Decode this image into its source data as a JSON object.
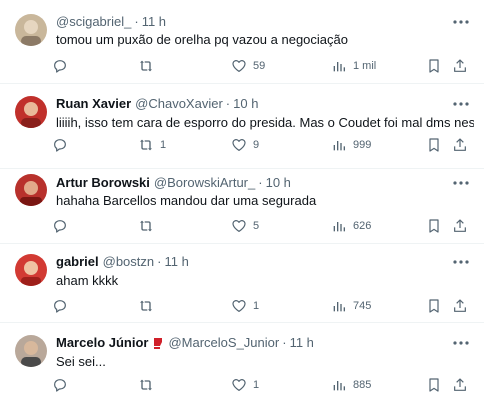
{
  "tweets": [
    {
      "name": "",
      "handle": "@scigabriel_",
      "dot": "·",
      "time": "11 h",
      "text": "tomou um puxão de orelha pq vazou a negociação",
      "replies": "",
      "retweets": "",
      "likes": "59",
      "views": "1 mil",
      "avatar_color": "#c9b79b"
    },
    {
      "name": "Ruan Xavier",
      "handle": "@ChavoXavier",
      "dot": "·",
      "time": "10 h",
      "text": "liiiih, isso tem cara de esporro do presida. Mas o Coudet foi mal dms nessa",
      "replies": "",
      "retweets": "1",
      "likes": "9",
      "views": "999",
      "avatar_color": "#c0302b"
    },
    {
      "name": "Artur Borowski",
      "handle": "@BorowskiArtur_",
      "dot": "·",
      "time": "10 h",
      "text": "hahaha Barcellos mandou dar uma segurada",
      "replies": "",
      "retweets": "",
      "likes": "5",
      "views": "626",
      "avatar_color": "#b8312c"
    },
    {
      "name": "gabriel",
      "handle": "@bostzn",
      "dot": "·",
      "time": "11 h",
      "text": "aham kkkk",
      "replies": "",
      "retweets": "",
      "likes": "1",
      "views": "745",
      "avatar_color": "#d23a33"
    },
    {
      "name": "Marcelo Júnior",
      "handle": "@MarceloS_Junior",
      "dot": "·",
      "time": "11 h",
      "text": "Sei sei...",
      "replies": "",
      "retweets": "",
      "likes": "1",
      "views": "885",
      "avatar_color": "#b9a89a",
      "badge_color": "#d0202a"
    }
  ],
  "colors": {
    "text_primary": "#0f1419",
    "text_secondary": "#536471",
    "divider": "#eff3f4"
  },
  "icons": [
    "reply-icon",
    "retweet-icon",
    "like-icon",
    "views-icon",
    "bookmark-icon",
    "share-icon",
    "more-icon"
  ]
}
